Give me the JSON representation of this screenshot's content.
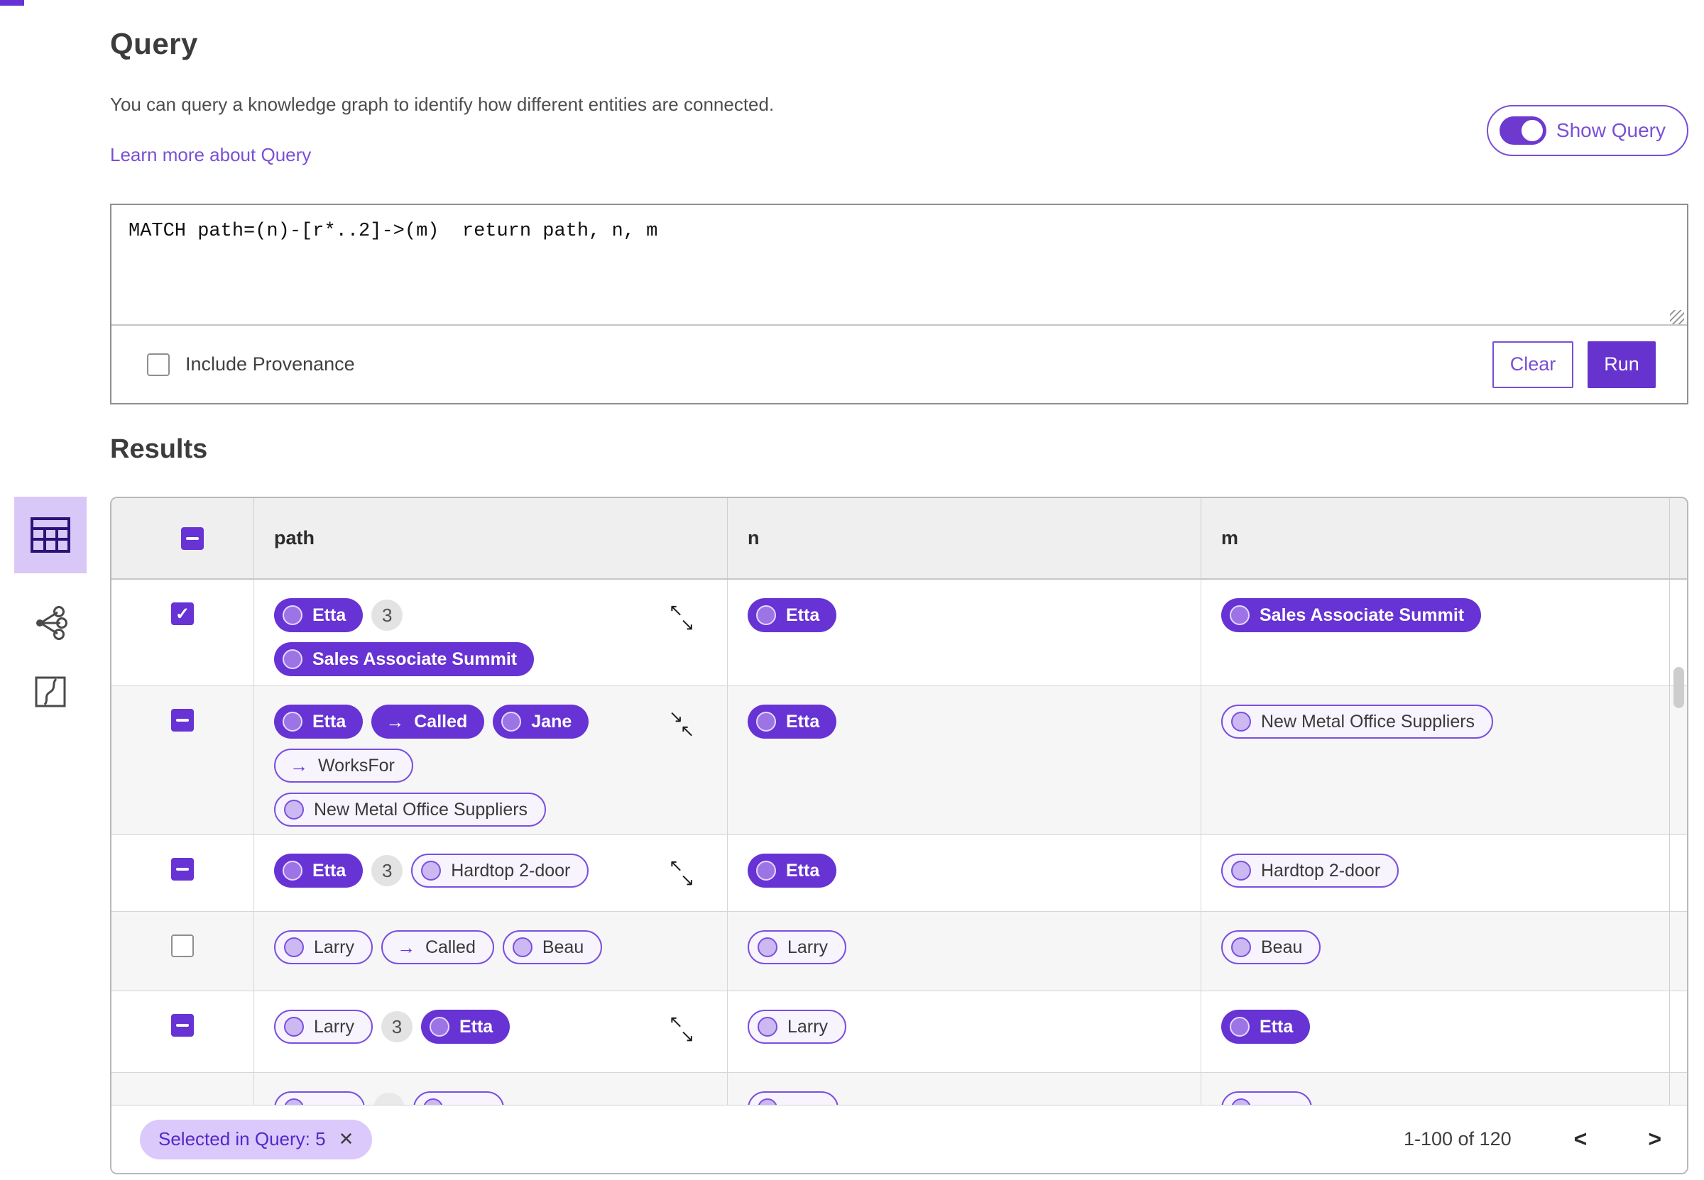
{
  "colors": {
    "accent": "#6733d4",
    "accent_outline": "#7a4fe0",
    "accent_light": "#dcc9fb",
    "link": "#7a4fd6",
    "header_bg": "#efefef"
  },
  "header": {
    "title": "Query",
    "description": "You can query a knowledge graph to identify how different entities are connected.",
    "learn_more": "Learn more about Query",
    "show_query_label": "Show Query",
    "show_query_on": true
  },
  "query_editor": {
    "text": "MATCH path=(n)-[r*..2]->(m)  return path, n, m",
    "include_provenance_label": "Include Provenance",
    "include_provenance_checked": false,
    "clear_label": "Clear",
    "run_label": "Run"
  },
  "results": {
    "title": "Results",
    "view_switcher": [
      {
        "name": "table-view",
        "selected": true
      },
      {
        "name": "graph-view",
        "selected": false
      },
      {
        "name": "map-view",
        "selected": false
      }
    ],
    "table": {
      "columns": [
        "path",
        "n",
        "m"
      ],
      "header_checkbox": "indeterminate",
      "rows": [
        {
          "checkbox": "checked",
          "path_lines": [
            [
              {
                "t": "node-solid",
                "label": "Etta"
              },
              {
                "t": "badge",
                "label": "3"
              }
            ],
            [
              {
                "t": "node-solid",
                "label": "Sales Associate Summit"
              }
            ]
          ],
          "resize": "expand",
          "n": {
            "t": "node-solid",
            "label": "Etta"
          },
          "m": {
            "t": "node-solid",
            "label": "Sales Associate Summit"
          }
        },
        {
          "checkbox": "indeterminate",
          "path_lines": [
            [
              {
                "t": "node-solid",
                "label": "Etta"
              },
              {
                "t": "edge-solid",
                "label": "Called"
              },
              {
                "t": "node-solid",
                "label": "Jane"
              }
            ],
            [
              {
                "t": "edge-outline",
                "label": "WorksFor"
              }
            ],
            [
              {
                "t": "node-outline",
                "label": "New Metal Office Suppliers"
              }
            ]
          ],
          "resize": "collapse",
          "n": {
            "t": "node-solid",
            "label": "Etta"
          },
          "m": {
            "t": "node-outline",
            "label": "New Metal Office Suppliers"
          }
        },
        {
          "checkbox": "indeterminate",
          "path_lines": [
            [
              {
                "t": "node-solid",
                "label": "Etta"
              },
              {
                "t": "badge",
                "label": "3"
              },
              {
                "t": "node-outline",
                "label": "Hardtop 2-door"
              }
            ]
          ],
          "resize": "expand",
          "n": {
            "t": "node-solid",
            "label": "Etta"
          },
          "m": {
            "t": "node-outline",
            "label": "Hardtop 2-door"
          }
        },
        {
          "checkbox": "unchecked",
          "path_lines": [
            [
              {
                "t": "node-outline",
                "label": "Larry"
              },
              {
                "t": "edge-outline",
                "label": "Called"
              },
              {
                "t": "node-outline",
                "label": "Beau"
              }
            ]
          ],
          "resize": null,
          "n": {
            "t": "node-outline",
            "label": "Larry"
          },
          "m": {
            "t": "node-outline",
            "label": "Beau"
          }
        },
        {
          "checkbox": "indeterminate",
          "path_lines": [
            [
              {
                "t": "node-outline",
                "label": "Larry"
              },
              {
                "t": "badge",
                "label": "3"
              },
              {
                "t": "node-solid",
                "label": "Etta"
              }
            ]
          ],
          "resize": "expand",
          "n": {
            "t": "node-outline",
            "label": "Larry"
          },
          "m": {
            "t": "node-solid",
            "label": "Etta"
          }
        },
        {
          "partial": true,
          "checkbox": "none",
          "path_lines": [
            [
              {
                "t": "node-outline",
                "label": ""
              },
              {
                "t": "badge",
                "label": ""
              },
              {
                "t": "node-outline",
                "label": ""
              }
            ]
          ],
          "resize": null,
          "n": {
            "t": "node-outline",
            "label": ""
          },
          "m": {
            "t": "node-outline",
            "label": ""
          }
        }
      ]
    },
    "footer": {
      "filter_chip": "Selected in Query: 5",
      "chip_close": "✕",
      "range_label": "1-100 of 120"
    }
  }
}
